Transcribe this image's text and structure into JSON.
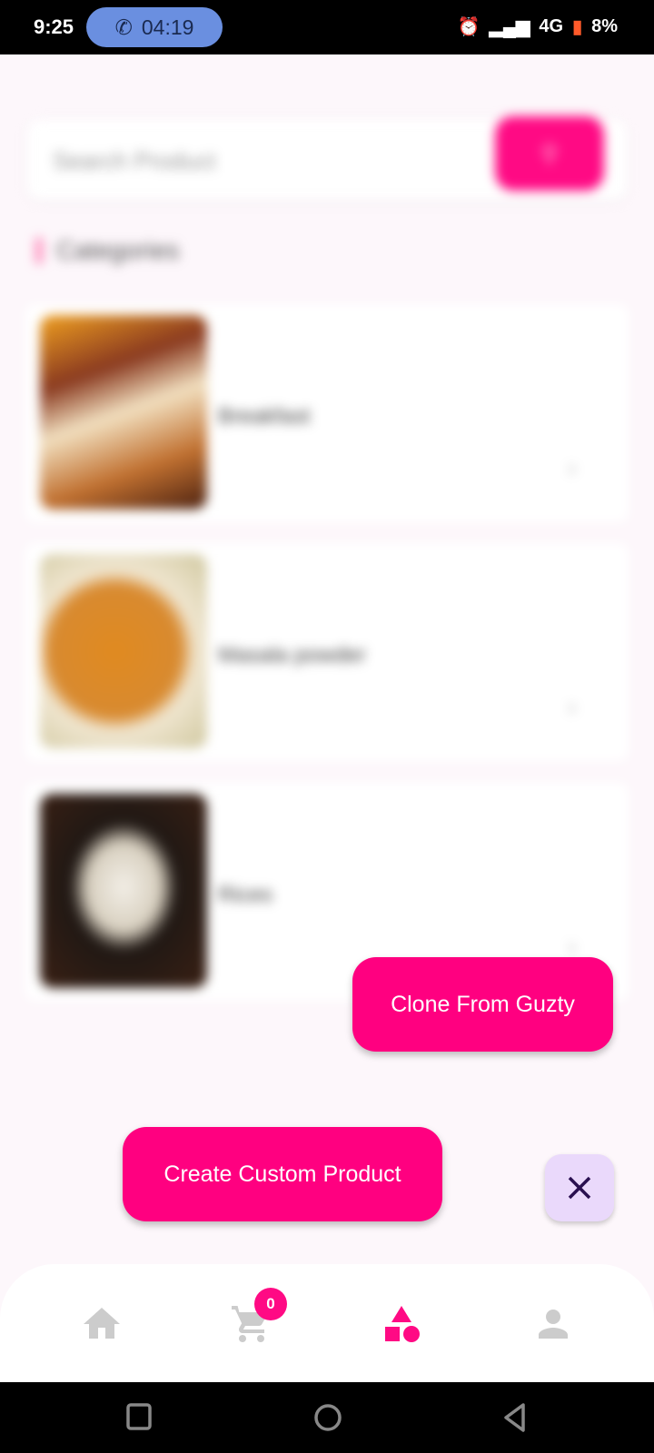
{
  "status_bar": {
    "time": "9:25",
    "call_timer": "04:19",
    "network": "4G",
    "battery": "8%"
  },
  "search": {
    "placeholder": "Search Product"
  },
  "categories": {
    "title": "Categories",
    "items": [
      {
        "label": "Breakfast"
      },
      {
        "label": "Masala powder"
      },
      {
        "label": "Rices"
      }
    ]
  },
  "actions": {
    "clone": "Clone From Guzty",
    "create": "Create Custom Product"
  },
  "bottom_nav": {
    "cart_count": "0",
    "items": [
      "home",
      "cart",
      "categories",
      "profile"
    ],
    "active": "categories"
  },
  "colors": {
    "accent": "#ff0080",
    "inactive": "#cccccc",
    "fab_close": "#ead9fb"
  }
}
